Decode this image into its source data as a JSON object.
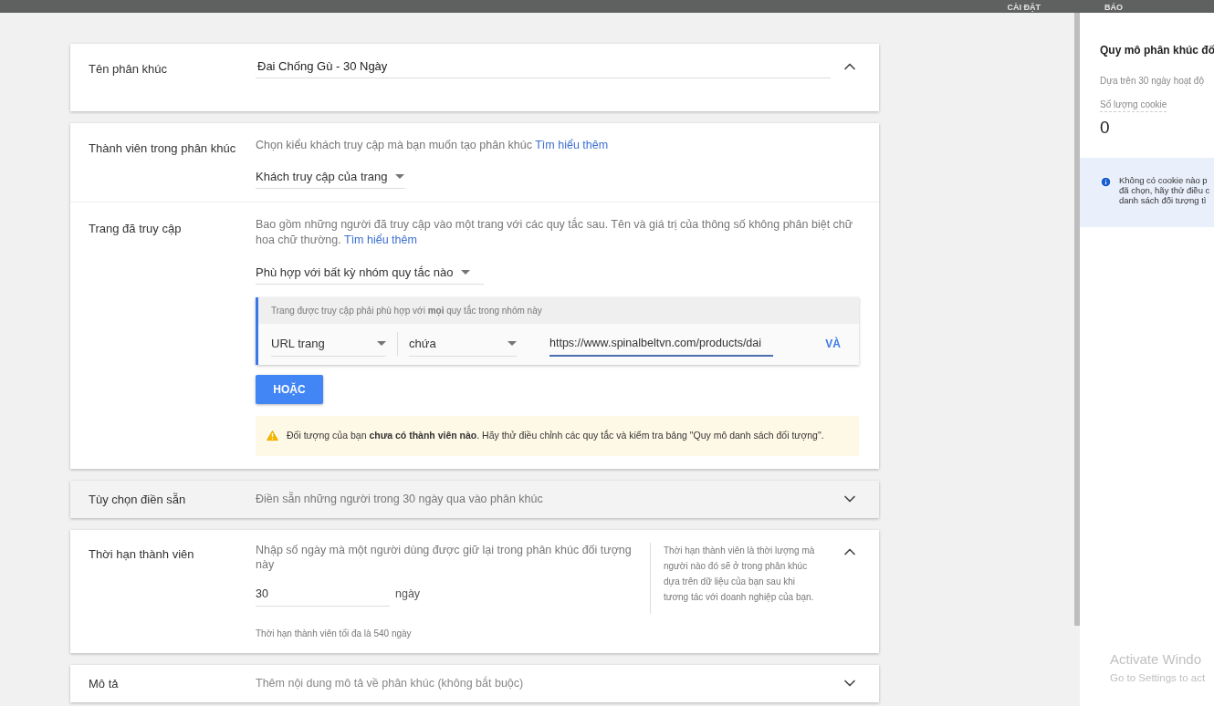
{
  "top_bar": {
    "items": [
      "CÀI ĐẶT",
      "BÁO"
    ]
  },
  "segment_name": {
    "label": "Tên phân khúc",
    "value": "Đai Chống Gù - 30 Ngày",
    "expanded": true
  },
  "members": {
    "label": "Thành viên trong phân khúc",
    "description": "Chọn kiểu khách truy cập mà bạn muốn tạo phân khúc",
    "link": "Tìm hiểu thêm",
    "dropdown": "Khách truy cập của trang"
  },
  "visited_pages": {
    "label": "Trang đã truy cập",
    "description": "Bao gồm những người đã truy cập vào một trang với các quy tắc sau. Tên và giá trị của thông số không phân biệt chữ hoa chữ thường.",
    "link": "Tìm hiểu thêm",
    "match_dropdown": "Phù hợp với bất kỳ nhóm quy tắc nào",
    "rule_group": {
      "header": "Trang được truy cập phải phù hợp với **mọi** quy tắc trong nhóm này",
      "rules": [
        {
          "field": "URL trang",
          "operator": "chứa",
          "value": "https://www.spinalbeltvn.com/products/dai",
          "and_button": "VÀ"
        }
      ]
    },
    "or_button": "HOẶC",
    "warning": "Đối tượng của bạn **chưa có thành viên nào**. Hãy thử điều chỉnh các quy tắc và kiểm tra bảng \"Quy mô danh sách đối tượng\"."
  },
  "prefill": {
    "label": "Tùy chọn điền sẵn",
    "description": "Điền sẵn những người trong 30 ngày qua vào phân khúc",
    "expanded": false
  },
  "duration": {
    "label": "Thời hạn thành viên",
    "description": "Nhập số ngày mà một người dùng được giữ lại trong phân khúc đối tượng này",
    "value": "30",
    "unit": "ngày",
    "note": "Thời hạn thành viên tối đa là 540 ngày",
    "help": "Thời hạn thành viên là thời lượng mà người nào đó sẽ ở trong phân khúc dựa trên dữ liệu của bạn sau khi tương tác với doanh nghiệp của bạn.",
    "expanded": true
  },
  "description": {
    "label": "Mô tả",
    "placeholder": "Thêm nội dung mô tả về phân khúc (không bắt buộc)",
    "expanded": false
  },
  "size_panel": {
    "title": "Quy mô phân khúc đố",
    "subtitle": "Dựa trên 30 ngày hoạt độ",
    "metric_label": "Số lượng cookie",
    "metric_value": "0",
    "info_lines": [
      "Không có cookie nào p",
      "đã chọn, hãy thử điều c",
      "danh sách đối tượng tì"
    ]
  },
  "os_notice": {
    "title": "Activate Windo",
    "subtitle": "Go to Settings to act"
  }
}
